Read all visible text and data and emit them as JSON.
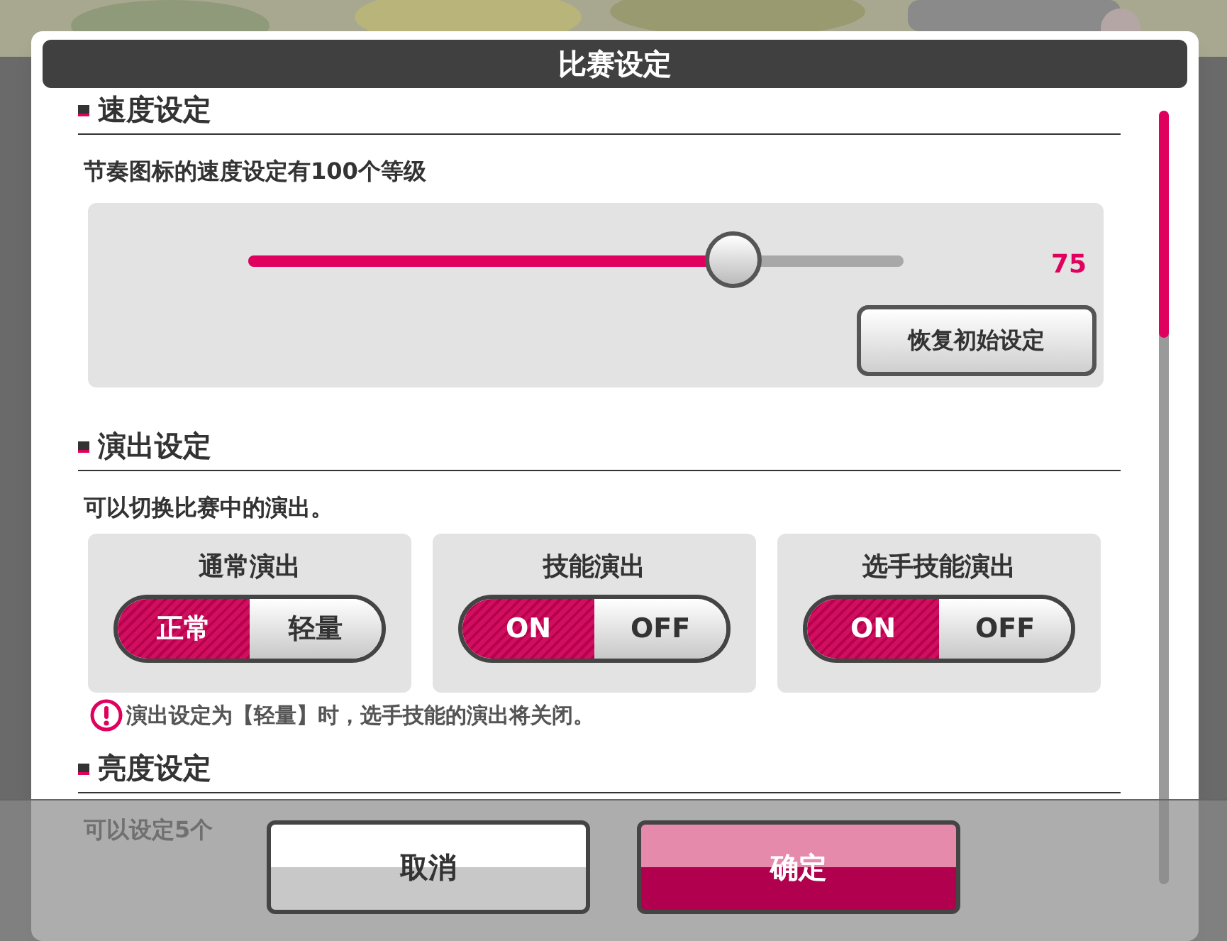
{
  "dialog": {
    "title": "比赛设定"
  },
  "speed": {
    "heading": "速度设定",
    "description": "节奏图标的速度设定有100个等级",
    "level": 0.74,
    "value": "75",
    "reset_button": "恢复初始设定"
  },
  "performance": {
    "heading": "演出设定",
    "description": "可以切换比赛中的演出。",
    "toggles": [
      {
        "title": "通常演出",
        "options": [
          {
            "label": "正常",
            "selected": true
          },
          {
            "label": "轻量",
            "selected": false
          }
        ]
      },
      {
        "title": "技能演出",
        "options": [
          {
            "label": "ON",
            "selected": true
          },
          {
            "label": "OFF",
            "selected": false
          }
        ]
      },
      {
        "title": "选手技能演出",
        "options": [
          {
            "label": "ON",
            "selected": true
          },
          {
            "label": "OFF",
            "selected": false
          }
        ]
      }
    ],
    "warning": "演出设定为【轻量】时，选手技能的演出将关闭。"
  },
  "brightness": {
    "heading": "亮度设定",
    "description": "可以设定5个"
  },
  "buttons": [
    {
      "label": "取消",
      "kind": "cancel"
    },
    {
      "label": "确定",
      "kind": "confirm"
    }
  ]
}
